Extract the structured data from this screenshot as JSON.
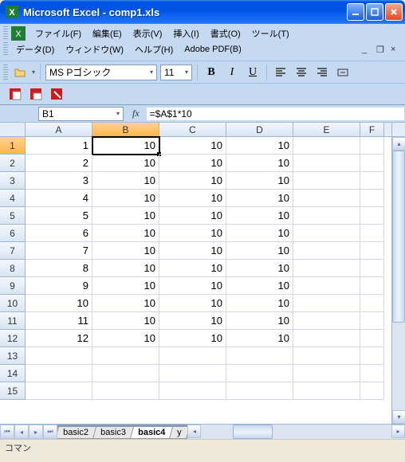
{
  "window": {
    "title": "Microsoft Excel - comp1.xls"
  },
  "menu": {
    "file": "ファイル(F)",
    "edit": "編集(E)",
    "view": "表示(V)",
    "insert": "挿入(I)",
    "format": "書式(O)",
    "tools": "ツール(T)",
    "data": "データ(D)",
    "window": "ウィンドウ(W)",
    "help": "ヘルプ(H)",
    "adobe": "Adobe PDF(B)"
  },
  "toolbar": {
    "font_name": "MS Pゴシック",
    "font_size": "11"
  },
  "formula": {
    "cell_ref": "B1",
    "fx_label": "fx",
    "content": "=$A$1*10"
  },
  "columns": [
    "A",
    "B",
    "C",
    "D",
    "E",
    "F"
  ],
  "row_labels": [
    "1",
    "2",
    "3",
    "4",
    "5",
    "6",
    "7",
    "8",
    "9",
    "10",
    "11",
    "12",
    "13",
    "14",
    "15"
  ],
  "grid": [
    [
      "1",
      "10",
      "10",
      "10",
      "",
      ""
    ],
    [
      "2",
      "10",
      "10",
      "10",
      "",
      ""
    ],
    [
      "3",
      "10",
      "10",
      "10",
      "",
      ""
    ],
    [
      "4",
      "10",
      "10",
      "10",
      "",
      ""
    ],
    [
      "5",
      "10",
      "10",
      "10",
      "",
      ""
    ],
    [
      "6",
      "10",
      "10",
      "10",
      "",
      ""
    ],
    [
      "7",
      "10",
      "10",
      "10",
      "",
      ""
    ],
    [
      "8",
      "10",
      "10",
      "10",
      "",
      ""
    ],
    [
      "9",
      "10",
      "10",
      "10",
      "",
      ""
    ],
    [
      "10",
      "10",
      "10",
      "10",
      "",
      ""
    ],
    [
      "11",
      "10",
      "10",
      "10",
      "",
      ""
    ],
    [
      "12",
      "10",
      "10",
      "10",
      "",
      ""
    ],
    [
      "",
      "",
      "",
      "",
      "",
      ""
    ],
    [
      "",
      "",
      "",
      "",
      "",
      ""
    ],
    [
      "",
      "",
      "",
      "",
      "",
      ""
    ]
  ],
  "active_cell": {
    "row": 0,
    "col": 1
  },
  "tabs": {
    "t1": "basic2",
    "t2": "basic3",
    "t3": "basic4",
    "t4": "y"
  },
  "status": "コマン"
}
